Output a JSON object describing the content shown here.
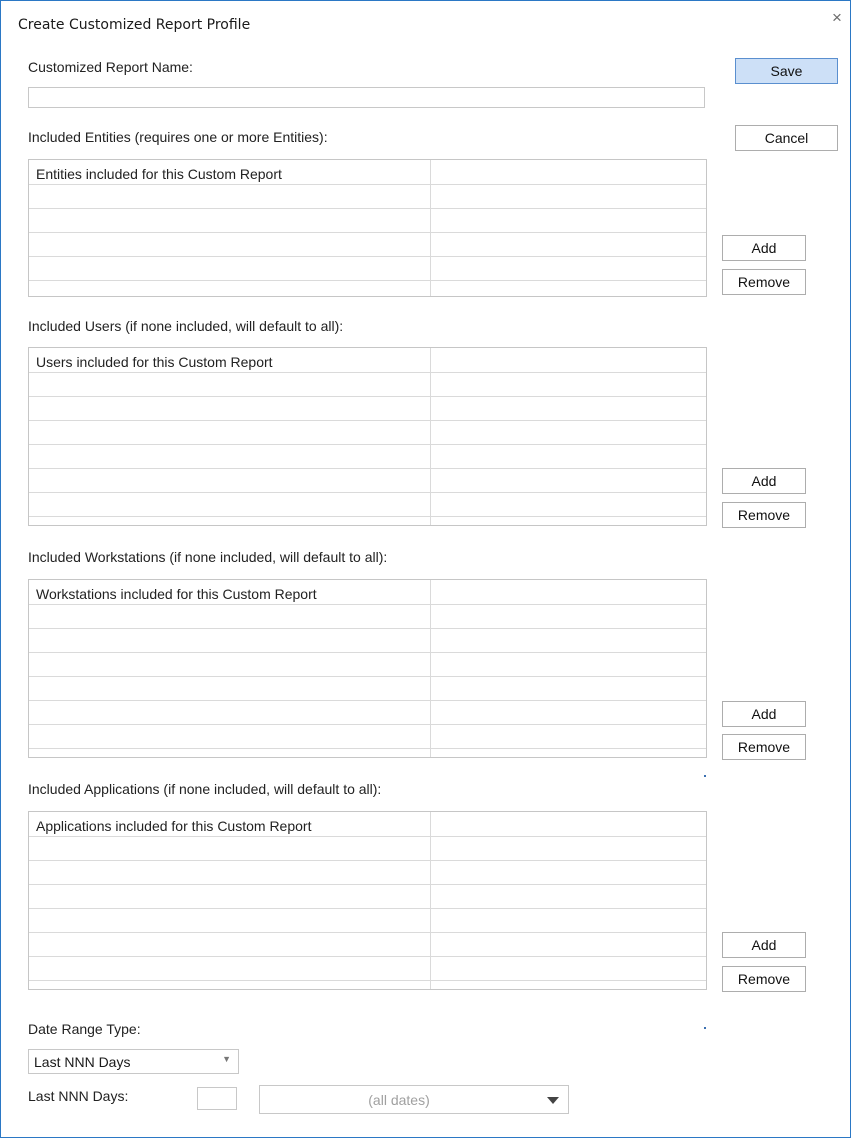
{
  "dialog": {
    "title": "Create Customized Report Profile",
    "close_glyph": "×"
  },
  "report_name": {
    "label": "Customized Report Name:",
    "value": "",
    "placeholder": ""
  },
  "actions": {
    "save_label": "Save",
    "cancel_label": "Cancel"
  },
  "sections": [
    {
      "label": "Included Entities (requires one or more Entities):",
      "grid_header": "Entities included for this Custom Report",
      "add_label": "Add",
      "remove_label": "Remove"
    },
    {
      "label": "Included Users (if none included, will default to all):",
      "grid_header": "Users included for this Custom Report",
      "add_label": "Add",
      "remove_label": "Remove"
    },
    {
      "label": "Included Workstations (if none included, will default to all):",
      "grid_header": "Workstations included for this Custom Report",
      "add_label": "Add",
      "remove_label": "Remove"
    },
    {
      "label": "Included Applications (if none included, will default to all):",
      "grid_header": "Applications included for this Custom Report",
      "add_label": "Add",
      "remove_label": "Remove"
    }
  ],
  "date_range": {
    "label": "Date Range Type:",
    "type_value": "Last NNN Days",
    "days_label": "Last NNN Days:",
    "days_value": "",
    "dates_value": "(all dates)"
  },
  "icons": {
    "close": "close-icon",
    "dropdown": "chevron-down-icon"
  }
}
